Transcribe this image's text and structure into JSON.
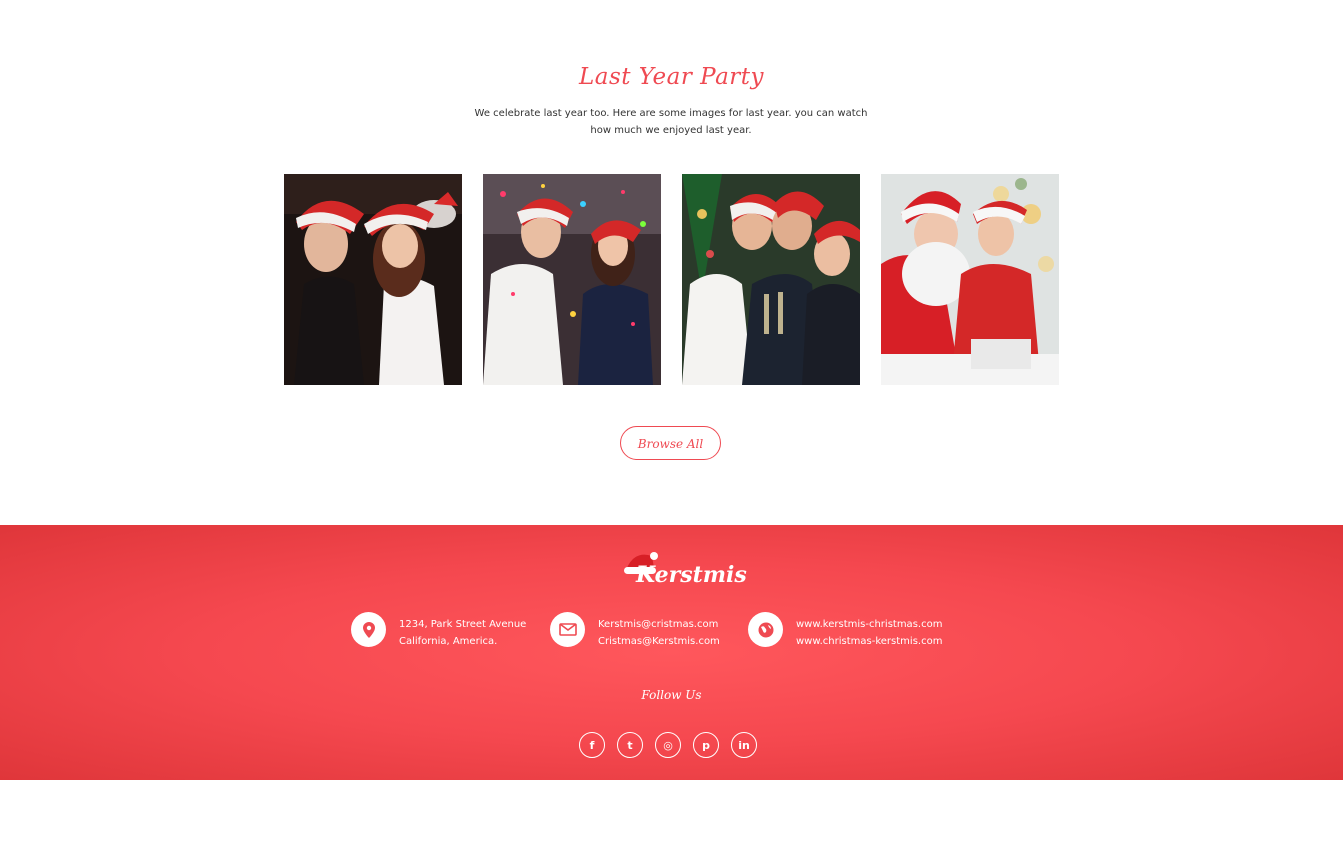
{
  "party": {
    "title": "Last Year Party",
    "description": "We celebrate last year too. Here are some images for last year. you can watch how much we enjoyed last year.",
    "browse_label": "Browse All"
  },
  "footer": {
    "brand": "Kerstmis",
    "address": [
      "1234, Park Street Avenue",
      "California, America."
    ],
    "emails": [
      "Kerstmis@cristmas.com",
      "Cristmas@Kerstmis.com"
    ],
    "websites": [
      "www.kerstmis-christmas.com",
      "www.christmas-kerstmis.com"
    ],
    "follow_label": "Follow Us",
    "social": [
      {
        "icon": "facebook-icon",
        "glyph": "f"
      },
      {
        "icon": "twitter-icon",
        "glyph": "t"
      },
      {
        "icon": "dribbble-icon",
        "glyph": "◎"
      },
      {
        "icon": "pinterest-icon",
        "glyph": "p"
      },
      {
        "icon": "linkedin-icon",
        "glyph": "in"
      }
    ]
  },
  "colors": {
    "accent": "#ef4a52",
    "footer_bg": "#f5484f"
  }
}
